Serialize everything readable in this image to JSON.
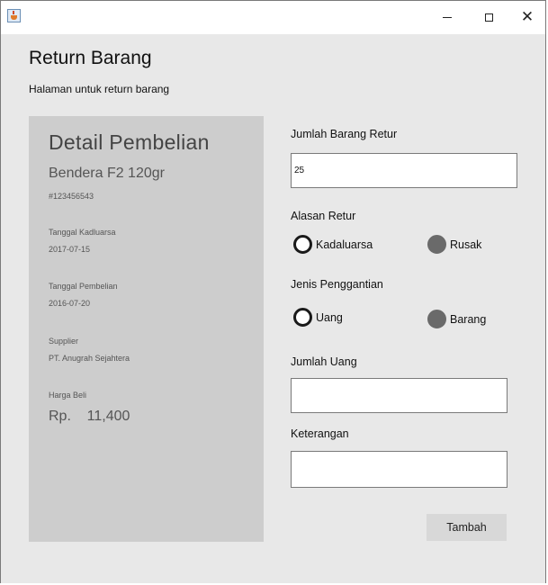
{
  "window": {
    "icon": "java-cup-icon",
    "minimize_glyph": "",
    "close_glyph": "✕"
  },
  "header": {
    "title": "Return Barang",
    "subtitle": "Halaman untuk return barang"
  },
  "detail": {
    "heading": "Detail Pembelian",
    "product_name": "Bendera F2 120gr",
    "product_code": "#123456543",
    "expiry_label": "Tanggal Kadluarsa",
    "expiry_value": "2017-07-15",
    "purchase_date_label": "Tanggal Pembelian",
    "purchase_date_value": "2016-07-20",
    "supplier_label": "Supplier",
    "supplier_value": "PT. Anugrah Sejahtera",
    "price_label": "Harga Beli",
    "price_value": "Rp.    11,400"
  },
  "form": {
    "return_qty_label": "Jumlah Barang Retur",
    "return_qty_value": "25",
    "reason_label": "Alasan Retur",
    "reason_options": [
      {
        "label": "Kadaluarsa",
        "selected": false
      },
      {
        "label": "Rusak",
        "selected": true
      }
    ],
    "replacement_label": "Jenis Penggantian",
    "replacement_options": [
      {
        "label": "Uang",
        "selected": false
      },
      {
        "label": "Barang",
        "selected": true
      }
    ],
    "money_amount_label": "Jumlah Uang",
    "money_amount_value": "",
    "notes_label": "Keterangan",
    "notes_value": "",
    "submit_label": "Tambah"
  },
  "colors": {
    "background": "#e8e8e8",
    "panel": "#cdcdcd",
    "radio_selected": "#6a6a6a"
  }
}
